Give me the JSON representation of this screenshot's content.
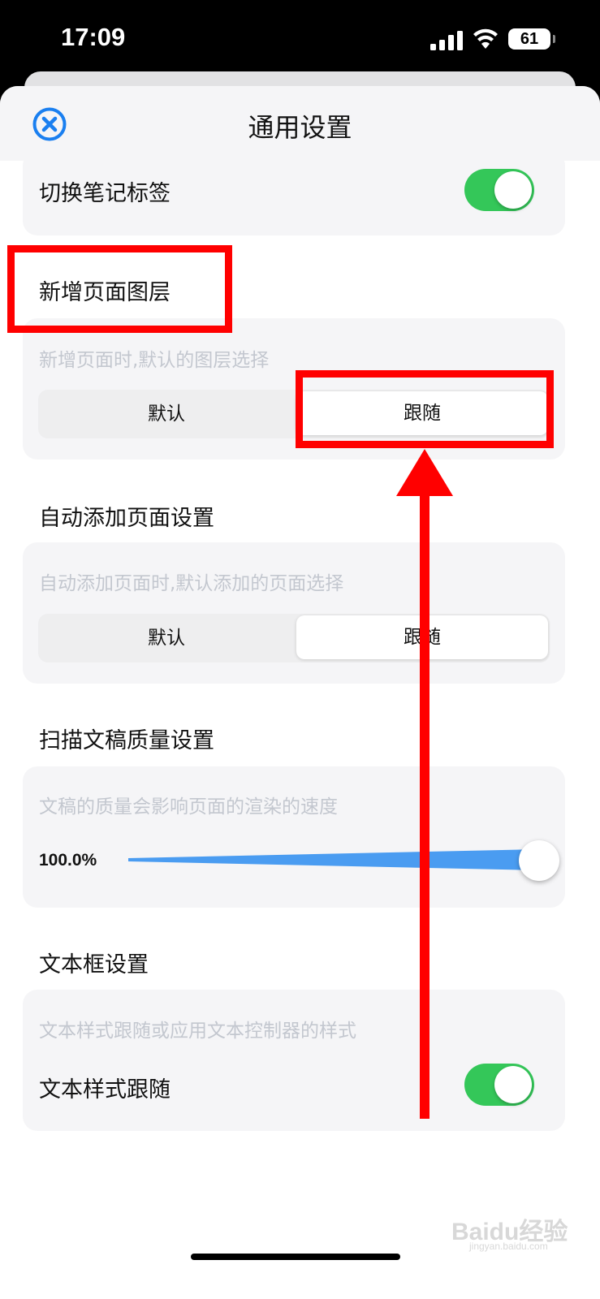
{
  "status_bar": {
    "time": "17:09",
    "battery": "61"
  },
  "header": {
    "title": "通用设置",
    "close_icon": "close-circle-icon"
  },
  "switch_note_tab": {
    "label": "切换笔记标签",
    "enabled": true
  },
  "new_page_layer": {
    "title": "新增页面图层",
    "description": "新增页面时,默认的图层选择",
    "options": [
      "默认",
      "跟随"
    ],
    "selected": "跟随"
  },
  "auto_add_page": {
    "title": "自动添加页面设置",
    "description": "自动添加页面时,默认添加的页面选择",
    "options": [
      "默认",
      "跟随"
    ],
    "selected": "跟随"
  },
  "scan_quality": {
    "title": "扫描文稿质量设置",
    "description": "文稿的质量会影响页面的渲染的速度",
    "value_label": "100.0%",
    "value_fraction": 1.0
  },
  "text_box": {
    "title": "文本框设置",
    "description": "文本样式跟随或应用文本控制器的样式",
    "toggle_label": "文本样式跟随",
    "enabled": true
  },
  "watermark": {
    "text": "Baidu经验",
    "sub": "jingyan.baidu.com"
  },
  "colors": {
    "accent": "#34c759",
    "slider": "#4a9cf1",
    "annotation": "#ff0000",
    "close": "#1a7ff0"
  }
}
